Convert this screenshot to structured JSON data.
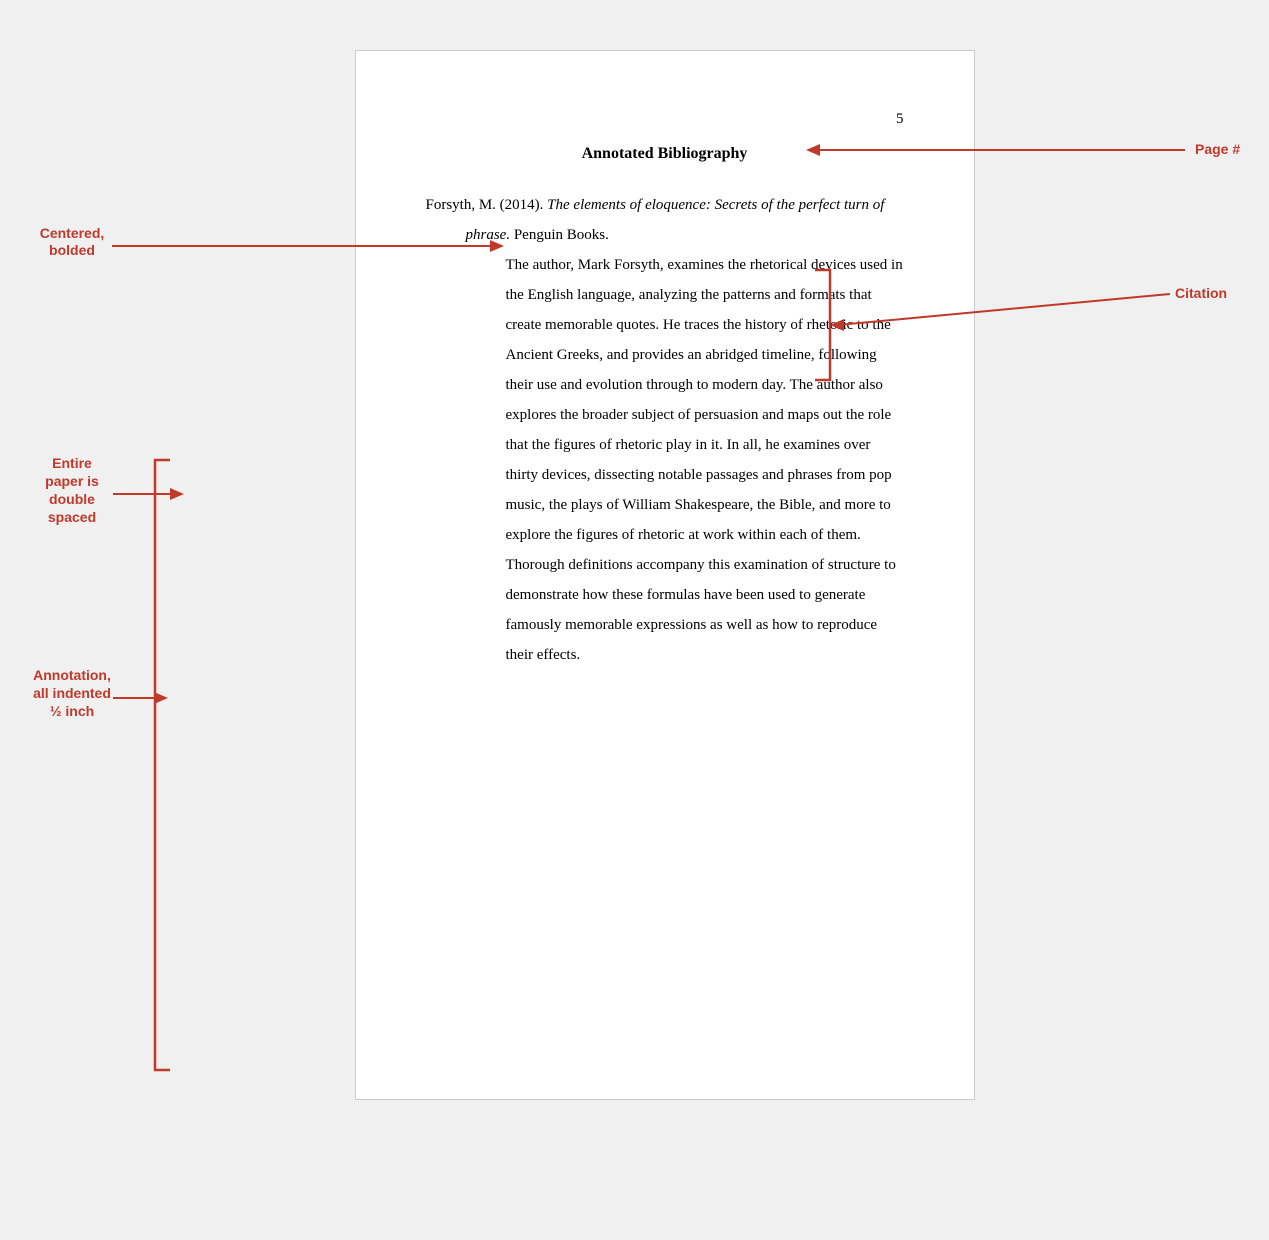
{
  "page": {
    "number": "5",
    "title": "Annotated Bibliography",
    "citation": {
      "text_normal_1": "Forsyth, M. (2014). ",
      "text_italic": "The elements of eloquence: Secrets of the perfect turn of phrase.",
      "text_normal_2": " Penguin Books."
    },
    "annotation": "The author, Mark Forsyth, examines the rhetorical devices used in the English language, analyzing the patterns and formats that create memorable quotes. He traces the history of rhetoric to the Ancient Greeks, and provides an abridged timeline, following their use and evolution through to modern day. The author also explores the broader subject of persuasion and maps out the role that the figures of rhetoric play in it. In all, he examines over thirty devices, dissecting notable passages and phrases from pop music, the plays of William Shakespeare, the Bible, and more to explore the figures of rhetoric at work within each of them. Thorough definitions accompany this examination of structure to demonstrate how these formulas have been used to generate famously memorable expressions as well as how to reproduce their effects."
  },
  "labels": {
    "centered_bolded": "Centered,\nbolded",
    "entire_paper": "Entire\npaper is\ndouble\nspaced",
    "annotation": "Annotation,\nall indented\n½ inch",
    "page_number": "Page #",
    "citation": "Citation"
  },
  "colors": {
    "accent": "#c0392b",
    "paper_border": "#ccc",
    "text": "#000"
  }
}
